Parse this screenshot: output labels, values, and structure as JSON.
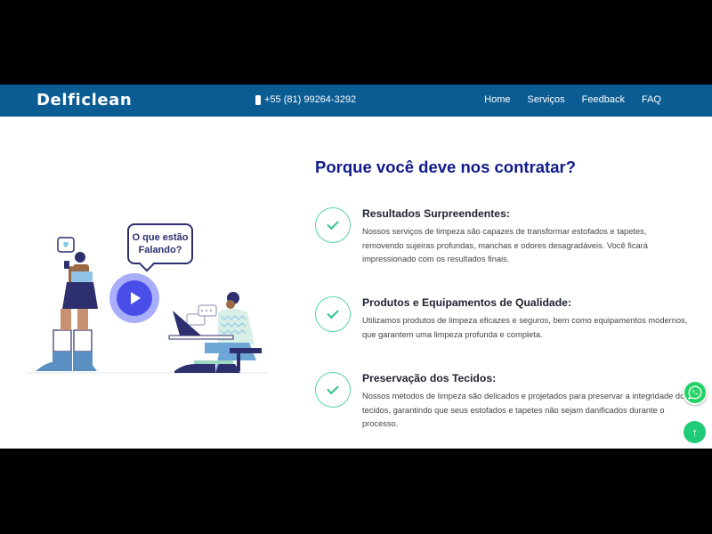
{
  "brand": "Delficlean",
  "header": {
    "phone": "+55 (81) 99264-3292",
    "phone_icon": "smartphone-icon",
    "nav": [
      "Home",
      "Serviços",
      "Feedback",
      "FAQ"
    ]
  },
  "video": {
    "bubble_text": "O que estão Falando?",
    "play_icon": "play-icon"
  },
  "section": {
    "heading": "Porque você deve nos contratar?",
    "features": [
      {
        "title": "Resultados Surpreendentes:",
        "text": "Nossos serviços de limpeza são capazes de transformar estofados e tapetes, removendo sujeiras profundas, manchas e odores desagradáveis. Você ficará impressionado com os resultados finais."
      },
      {
        "title": "Produtos e Equipamentos de Qualidade:",
        "text": "Utilizamos produtos de limpeza eficazes e seguros, bem como equipamentos modernos, que garantem uma limpeza profunda e completa."
      },
      {
        "title": "Preservação dos Tecidos:",
        "text": "Nossos métodos de limpeza são delicados e projetados para preservar a integridade dos tecidos, garantindo que seus estofados e tapetes não sejam danificados durante o processo."
      }
    ]
  },
  "floating": {
    "whatsapp_icon": "whatsapp-icon",
    "top_icon": "arrow-up-icon"
  },
  "colors": {
    "navbar": "#0b5c93",
    "heading": "#101a8c",
    "check": "#2ec58a",
    "play": "#4a4ee8"
  }
}
